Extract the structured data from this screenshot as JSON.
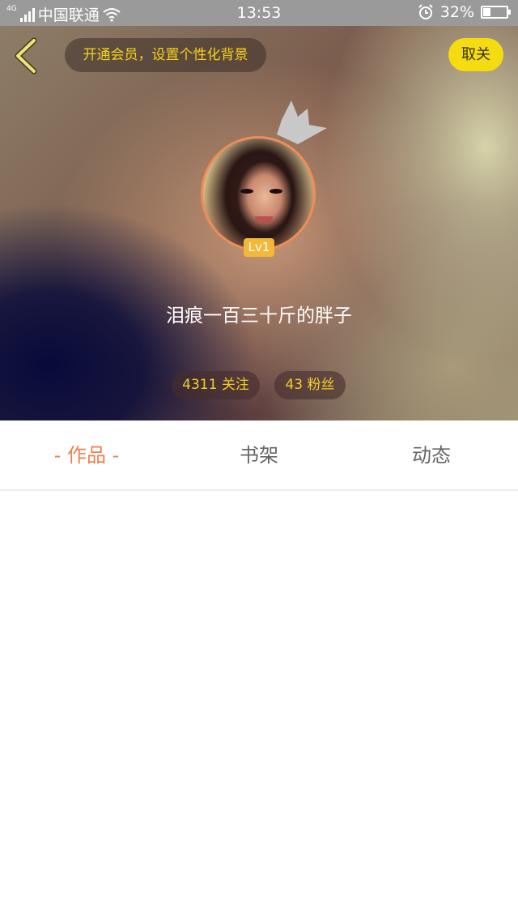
{
  "status_bar": {
    "network": "4G",
    "carrier": "中国联通",
    "time": "13:53",
    "battery": "32%",
    "battery_level": 0.32
  },
  "header": {
    "vip_prompt": "开通会员，设置个性化背景",
    "cancel_label": "取关"
  },
  "profile": {
    "level": "Lv1",
    "username": "泪痕一百三十斤的胖子",
    "following": "4311 关注",
    "fans": "43 粉丝"
  },
  "tabs": [
    {
      "label": "- 作品 -",
      "active": true
    },
    {
      "label": "书架",
      "active": false
    },
    {
      "label": "动态",
      "active": false
    }
  ],
  "colors": {
    "accent": "#ef7f4e",
    "yellow": "#f5dc10",
    "status_bar": "#9a9a9a"
  }
}
